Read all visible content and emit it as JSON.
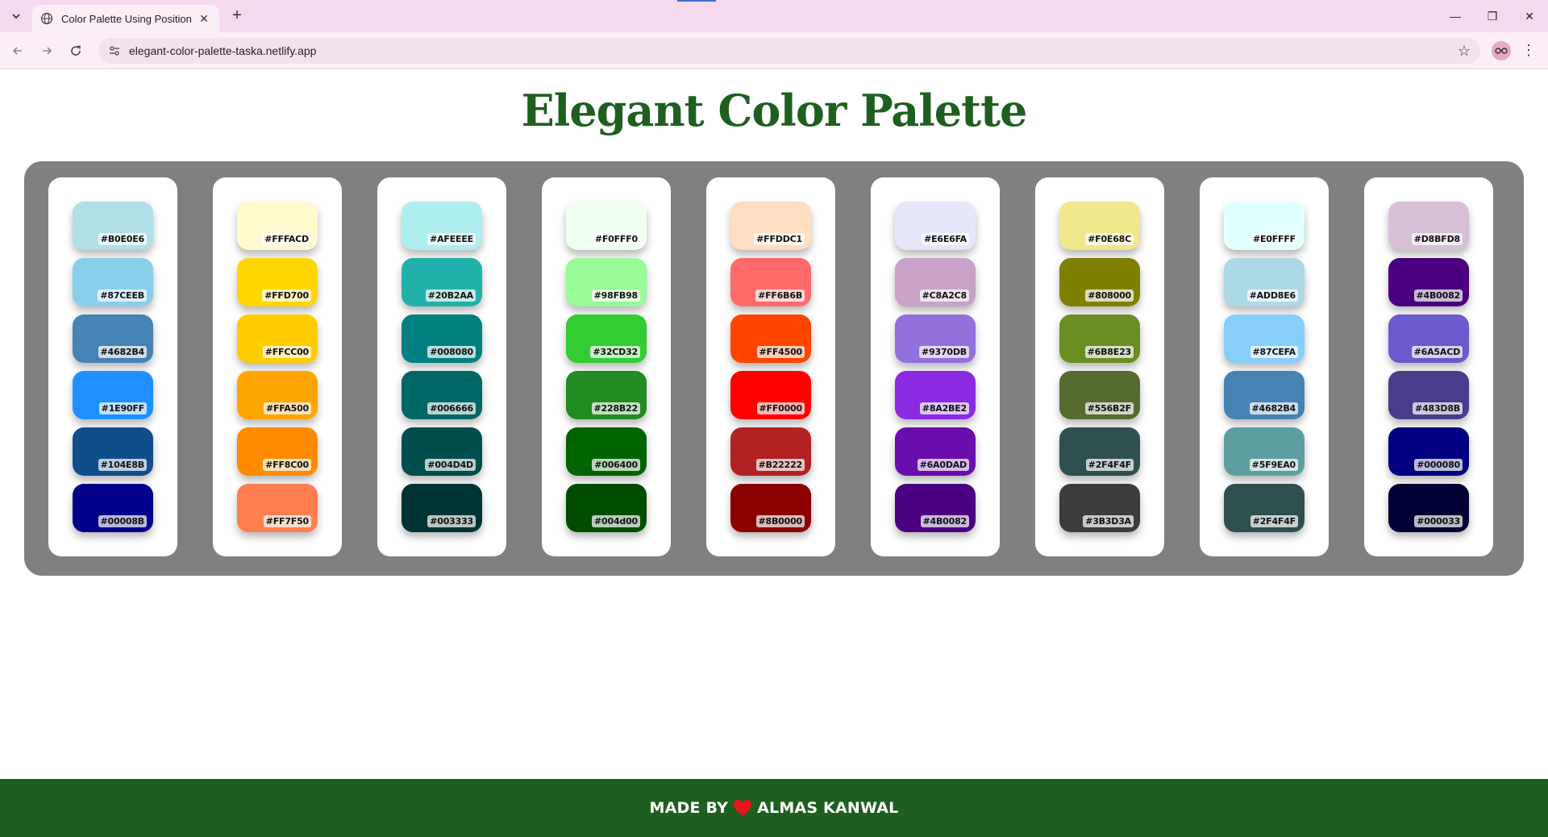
{
  "browser": {
    "tab_title": "Color Palette Using Position",
    "url": "elegant-color-palette-taska.netlify.app",
    "tab_list_icon": "chevron-down-icon",
    "new_tab_label": "+",
    "win_min": "—",
    "win_restore": "❐",
    "win_close": "✕"
  },
  "page": {
    "title": "Elegant Color Palette"
  },
  "palettes": [
    [
      "#B0E0E6",
      "#87CEEB",
      "#4682B4",
      "#1E90FF",
      "#104E8B",
      "#00008B"
    ],
    [
      "#FFFACD",
      "#FFD700",
      "#FFCC00",
      "#FFA500",
      "#FF8C00",
      "#FF7F50"
    ],
    [
      "#AFEEEE",
      "#20B2AA",
      "#008080",
      "#006666",
      "#004D4D",
      "#003333"
    ],
    [
      "#F0FFF0",
      "#98FB98",
      "#32CD32",
      "#228B22",
      "#006400",
      "#004d00"
    ],
    [
      "#FFDDC1",
      "#FF6B6B",
      "#FF4500",
      "#FF0000",
      "#B22222",
      "#8B0000"
    ],
    [
      "#E6E6FA",
      "#C8A2C8",
      "#9370DB",
      "#8A2BE2",
      "#6A0DAD",
      "#4B0082"
    ],
    [
      "#F0E68C",
      "#808000",
      "#6B8E23",
      "#556B2F",
      "#2F4F4F",
      "#3B3D3A"
    ],
    [
      "#E0FFFF",
      "#ADD8E6",
      "#87CEFA",
      "#4682B4",
      "#5F9EA0",
      "#2F4F4F"
    ],
    [
      "#D8BFD8",
      "#4B0082",
      "#6A5ACD",
      "#483D8B",
      "#000080",
      "#000033"
    ]
  ],
  "footer": {
    "prefix": "MADE BY",
    "author": "ALMAS KANWAL",
    "heart_color": "#e8141b"
  },
  "colors": {
    "accent_green": "#1e5f20",
    "board_gray": "#808080",
    "tabstrip_pink": "#f7d9ef"
  }
}
